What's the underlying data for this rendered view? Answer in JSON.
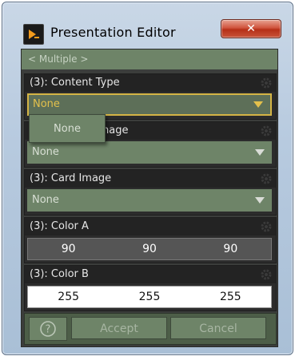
{
  "window": {
    "title": "Presentation Editor",
    "close_label": "✕"
  },
  "breadcrumb": "< Multiple >",
  "sections": [
    {
      "label": "(3): Content Type",
      "value": "None"
    },
    {
      "label": "(3): Content Image",
      "value": "None"
    },
    {
      "label": "(3): Card Image",
      "value": "None"
    }
  ],
  "popup": {
    "option": "None"
  },
  "color_a": {
    "label": "(3): Color A",
    "values": [
      "90",
      "90",
      "90"
    ]
  },
  "color_b": {
    "label": "(3): Color B",
    "values": [
      "255",
      "255",
      "255"
    ]
  },
  "footer": {
    "help_label": "?",
    "accept_label": "Accept",
    "cancel_label": "Cancel"
  },
  "colors": {
    "accent_yellow": "#e3c04c",
    "panel_green": "#6e8468",
    "dark_bg": "#2c2c2c"
  },
  "icons": [
    "app-icon",
    "close-icon",
    "gear-icon",
    "chevron-down-icon",
    "help-icon"
  ]
}
